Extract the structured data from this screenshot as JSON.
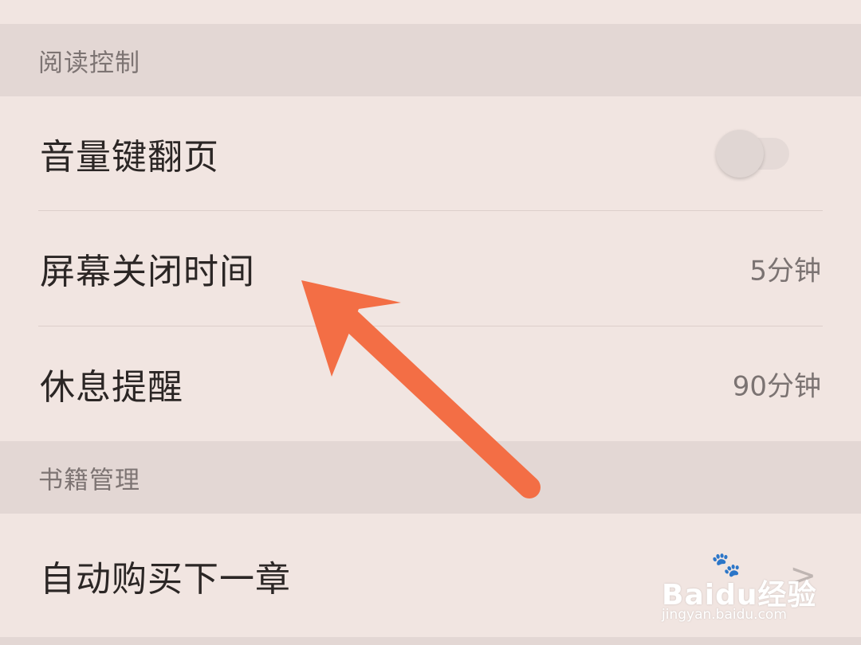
{
  "sections": [
    {
      "header": "阅读控制",
      "items": [
        {
          "title": "音量键翻页",
          "toggle": {
            "on": false
          }
        },
        {
          "title": "屏幕关闭时间",
          "value": "5分钟"
        },
        {
          "title": "休息提醒",
          "value": "90分钟"
        }
      ]
    },
    {
      "header": "书籍管理",
      "items": [
        {
          "title": "自动购买下一章",
          "chevron": ">"
        }
      ]
    }
  ],
  "watermark": {
    "brand": "Baidu经验",
    "url": "jingyan.baidu.com"
  },
  "colors": {
    "background": "#f1e5e1",
    "section_header": "#e3d7d4",
    "arrow": "#f36e45"
  }
}
